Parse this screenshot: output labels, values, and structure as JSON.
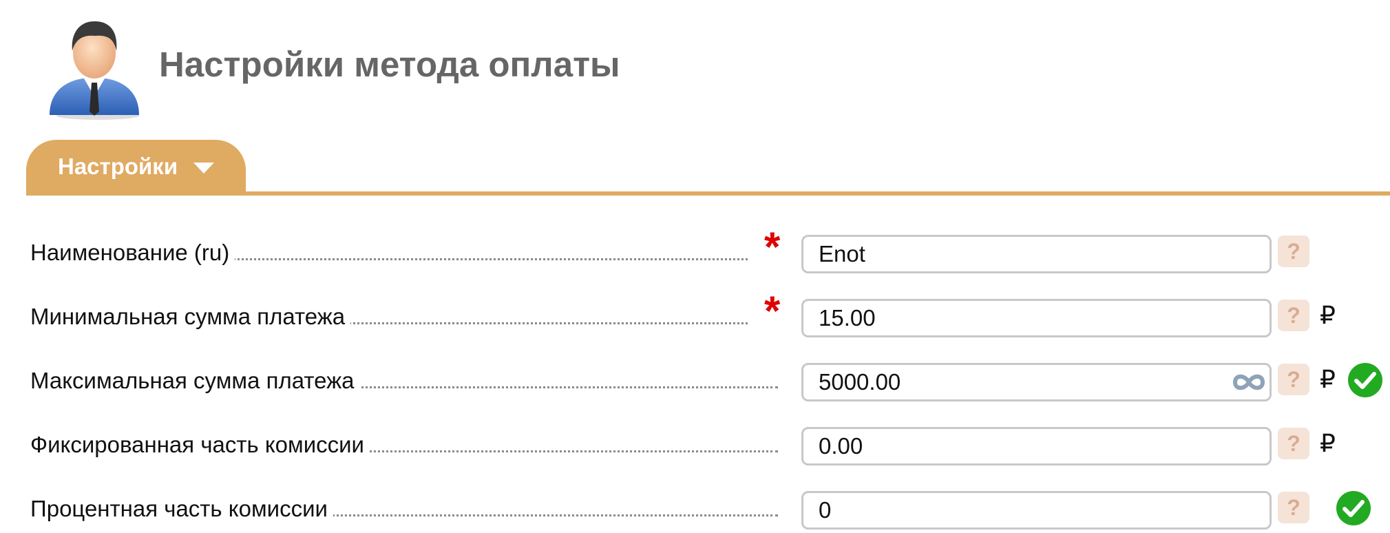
{
  "header": {
    "title": "Настройки метода оплаты",
    "avatar_icon": "user-avatar-icon"
  },
  "tabs": [
    {
      "label": "Настройки",
      "active": true,
      "has_dropdown": true
    }
  ],
  "colors": {
    "accent": "#dfaa62",
    "required": "#e00000",
    "help_bg": "#f5e3d8",
    "help_fg": "#d9ac93",
    "success": "#22aa22",
    "title": "#666666"
  },
  "form": {
    "fields": [
      {
        "label": "Наименование (ru)",
        "value": "Enot",
        "required": true,
        "required_mark": "*",
        "help": "?",
        "unit": "",
        "infinity_toggle": false,
        "status": ""
      },
      {
        "label": "Минимальная сумма платежа",
        "value": "15.00",
        "required": true,
        "required_mark": "*",
        "help": "?",
        "unit": "₽",
        "infinity_toggle": false,
        "status": ""
      },
      {
        "label": "Максимальная сумма платежа",
        "value": "5000.00",
        "required": false,
        "help": "?",
        "unit": "₽",
        "infinity_toggle": true,
        "status": "ok"
      },
      {
        "label": "Фиксированная часть комиссии",
        "value": "0.00",
        "required": false,
        "help": "?",
        "unit": "₽",
        "infinity_toggle": false,
        "status": ""
      },
      {
        "label": "Процентная часть комиссии",
        "value": "0",
        "required": false,
        "help": "?",
        "unit": "",
        "infinity_toggle": false,
        "status": "ok"
      }
    ]
  }
}
